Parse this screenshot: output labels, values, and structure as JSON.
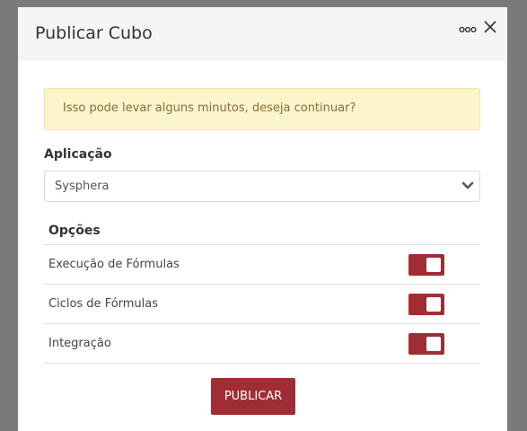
{
  "modal": {
    "title": "Publicar Cubo"
  },
  "alert": {
    "message": "Isso pode levar alguns minutos, deseja continuar?"
  },
  "application": {
    "label": "Aplicação",
    "selected": "Sysphera"
  },
  "options": {
    "header": "Opções",
    "items": [
      {
        "label": "Execução de Fórmulas",
        "enabled": true
      },
      {
        "label": "Ciclos de Fórmulas",
        "enabled": true
      },
      {
        "label": "Integração",
        "enabled": true
      }
    ]
  },
  "actions": {
    "publish_label": "PUBLICAR"
  },
  "colors": {
    "accent": "#a02d34",
    "alert_bg": "#fcf4cd",
    "alert_text": "#8a6d3b",
    "overlay": "#7a7a7a"
  }
}
